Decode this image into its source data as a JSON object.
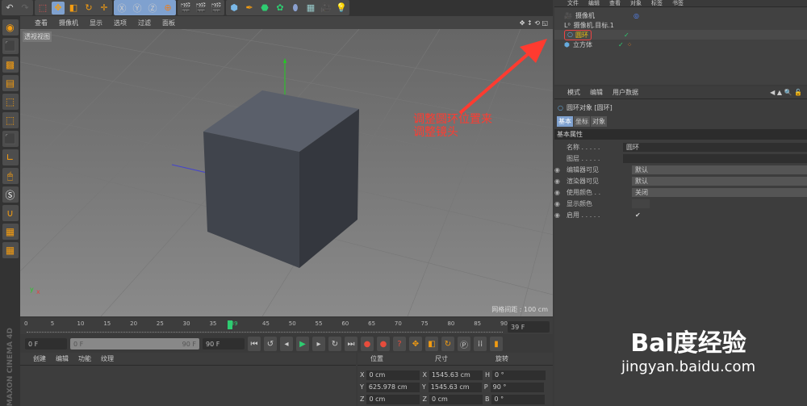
{
  "viewport": {
    "menu": [
      "查看",
      "摄像机",
      "显示",
      "选项",
      "过滤",
      "面板"
    ],
    "view_label": "透视视图",
    "grid_spacing": "网格间距 : 100 cm"
  },
  "annotation": {
    "line1": "调整圆环位置来",
    "line2": "调整镜头",
    "color": "#ff3b30"
  },
  "timeline": {
    "ticks": [
      "0",
      "5",
      "10",
      "15",
      "20",
      "25",
      "30",
      "35",
      "39",
      "45",
      "50",
      "55",
      "60",
      "65",
      "70",
      "75",
      "80",
      "85",
      "90"
    ],
    "current": "39",
    "current_field": "39 F",
    "start": "0 F",
    "range_start": "0 F",
    "range_end": "90 F",
    "end": "90 F"
  },
  "object_manager": {
    "menu": [
      "文件",
      "编辑",
      "查看",
      "对象",
      "标签",
      "书签"
    ],
    "objects": [
      "摄像机",
      "摄像机.目标.1",
      "圆环",
      "立方体"
    ]
  },
  "attributes": {
    "menu": [
      "模式",
      "编辑",
      "用户数据"
    ],
    "title": "圆环对象 [圆环]",
    "tabs": [
      "基本",
      "坐标",
      "对象"
    ],
    "section": "基本属性",
    "rows": [
      {
        "label": "名称 . . . . .",
        "value": "圆环"
      },
      {
        "label": "图层 . . . . .",
        "value": ""
      },
      {
        "label": "编辑器可见",
        "value": "默认"
      },
      {
        "label": "渲染器可见",
        "value": "默认"
      },
      {
        "label": "使用颜色 . .",
        "value": "关闭"
      },
      {
        "label": "显示颜色",
        "value": ""
      },
      {
        "label": "启用 . . . . .",
        "value": "✔"
      }
    ]
  },
  "materials": {
    "menu": [
      "创建",
      "编辑",
      "功能",
      "纹理"
    ]
  },
  "coordinates": {
    "headers": [
      "位置",
      "尺寸",
      "旋转"
    ],
    "rows": [
      [
        "X",
        "0 cm",
        "X",
        "1545.63 cm",
        "H",
        "0 °"
      ],
      [
        "Y",
        "625.978 cm",
        "Y",
        "1545.63 cm",
        "P",
        "90 °"
      ],
      [
        "Z",
        "0 cm",
        "Z",
        "0 cm",
        "B",
        "0 °"
      ]
    ]
  },
  "brand": "MAXON CINEMA 4D",
  "watermark": {
    "logo": "Bai度经验",
    "url": "jingyan.baidu.com"
  }
}
